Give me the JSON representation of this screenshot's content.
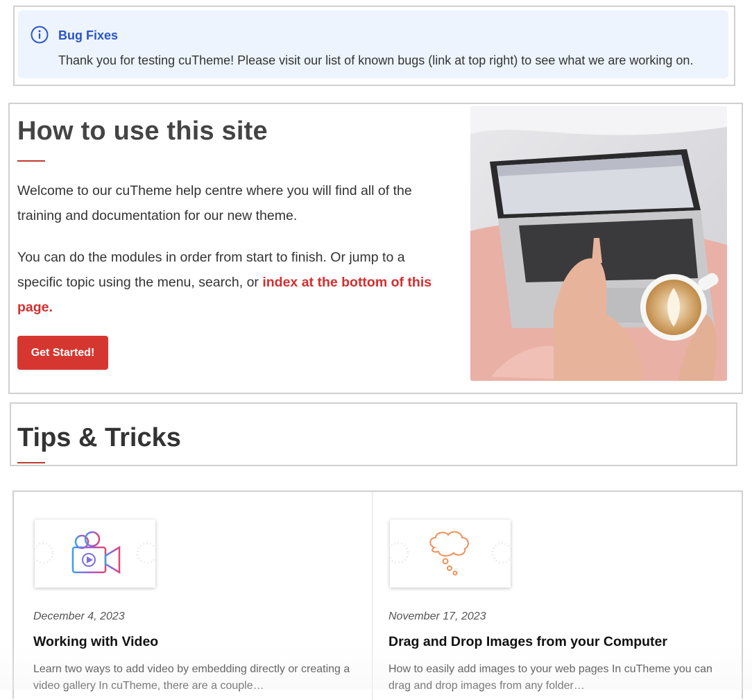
{
  "alert": {
    "title": "Bug Fixes",
    "text": "Thank you for testing cuTheme! Please visit our list of known bugs (link at top right) to see what we are working on.",
    "icon": "info-icon",
    "accent": "#2a55c8"
  },
  "hero": {
    "title": "How to use this site",
    "paragraph1": "Welcome to our cuTheme help centre where you will find all of the training and documentation for our new theme.",
    "paragraph2_prefix": "You can do the modules in order from start to finish. Or jump to a specific topic using the menu, search, or ",
    "paragraph2_link": "index at the bottom of this page.",
    "button_label": "Get Started!",
    "image": "laptop-with-coffee-photo",
    "accent": "#d63630"
  },
  "tips": {
    "title": "Tips & Tricks"
  },
  "cards": [
    {
      "icon": "video-camera-icon",
      "date": "December 4, 2023",
      "title": "Working with Video",
      "excerpt": "Learn two ways to add video by embedding directly or creating a video gallery In cuTheme, there are a couple…"
    },
    {
      "icon": "cloud-thought-icon",
      "date": "November 17, 2023",
      "title": "Drag and Drop Images from your Computer",
      "excerpt": "How to easily add images to your web pages In cuTheme you can drag and drop images from any folder…"
    }
  ]
}
